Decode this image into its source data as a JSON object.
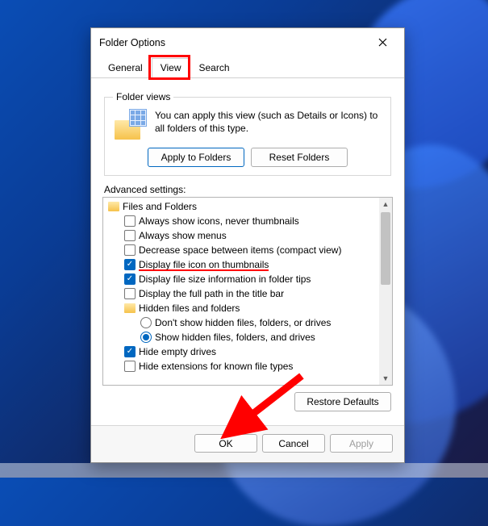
{
  "dialog": {
    "title": "Folder Options",
    "tabs": [
      {
        "label": "General",
        "active": false
      },
      {
        "label": "View",
        "active": true
      },
      {
        "label": "Search",
        "active": false
      }
    ],
    "folderViews": {
      "legend": "Folder views",
      "text": "You can apply this view (such as Details or Icons) to all folders of this type.",
      "applyLabel": "Apply to Folders",
      "resetLabel": "Reset Folders"
    },
    "advanced": {
      "label": "Advanced settings:",
      "rootLabel": "Files and Folders",
      "items": [
        {
          "type": "check",
          "checked": false,
          "label": "Always show icons, never thumbnails"
        },
        {
          "type": "check",
          "checked": false,
          "label": "Always show menus"
        },
        {
          "type": "check",
          "checked": false,
          "label": "Decrease space between items (compact view)"
        },
        {
          "type": "check",
          "checked": true,
          "label": "Display file icon on thumbnails",
          "underline": true
        },
        {
          "type": "check",
          "checked": true,
          "label": "Display file size information in folder tips"
        },
        {
          "type": "check",
          "checked": false,
          "label": "Display the full path in the title bar"
        },
        {
          "type": "folder",
          "label": "Hidden files and folders",
          "children": [
            {
              "type": "radio",
              "checked": false,
              "label": "Don't show hidden files, folders, or drives"
            },
            {
              "type": "radio",
              "checked": true,
              "label": "Show hidden files, folders, and drives"
            }
          ]
        },
        {
          "type": "check",
          "checked": true,
          "label": "Hide empty drives"
        },
        {
          "type": "check",
          "checked": false,
          "label": "Hide extensions for known file types"
        }
      ],
      "restoreLabel": "Restore Defaults"
    },
    "buttons": {
      "ok": "OK",
      "cancel": "Cancel",
      "apply": "Apply",
      "applyEnabled": false
    }
  },
  "annotation": {
    "highlightTab": "View",
    "underlineItem": "Display file icon on thumbnails",
    "arrowTarget": "OK"
  }
}
